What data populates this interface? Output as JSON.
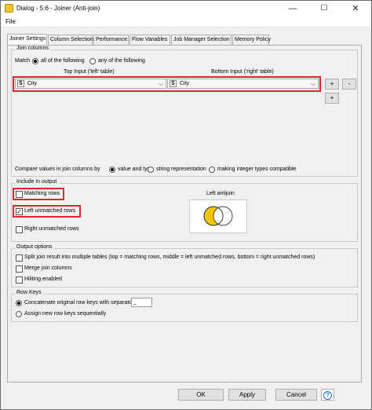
{
  "window": {
    "title": "Dialog - 5:6 - Joiner (Anti-join)",
    "minimize": "—",
    "maximize": "☐",
    "close": "✕"
  },
  "menu": {
    "file": "File"
  },
  "tabs": [
    "Joiner Settings",
    "Column Selection",
    "Performance",
    "Flow Variables",
    "Job Manager Selection",
    "Memory Policy"
  ],
  "join_columns": {
    "legend": "Join columns",
    "match_label": "Match",
    "match_all": "all of the following",
    "match_any": "any of the following",
    "top_header": "Top Input ('left' table)",
    "bottom_header": "Bottom Input ('right' table)",
    "left_column": "City",
    "right_column": "City",
    "type_badge": "S",
    "add": "+",
    "remove": "-",
    "compare_label": "Compare values in join columns by",
    "compare_value_type": "value and type",
    "compare_string": "string representation",
    "compare_integer": "making integer types compatible"
  },
  "include": {
    "legend": "Include in output",
    "matching_rows": "Matching rows",
    "matching_rows_checked": false,
    "left_unmatched": "Left unmatched rows",
    "left_unmatched_checked": true,
    "right_unmatched": "Right unmatched rows",
    "right_unmatched_checked": false,
    "venn_title": "Left antijoin",
    "venn_fill_color": "#f5c400"
  },
  "output_options": {
    "legend": "Output options",
    "split": "Split join result into multiple tables (top = matching rows, middle = left unmatched rows, bottom = right unmatched rows)",
    "merge": "Merge join columns",
    "hiliting": "Hiliting enabled"
  },
  "row_keys": {
    "legend": "Row Keys",
    "concatenate": "Concatenate original row keys with separator",
    "separator": "_",
    "assign_new": "Assign new row keys sequentially"
  },
  "buttons": {
    "ok": "OK",
    "apply": "Apply",
    "cancel": "Cancel",
    "help": "?"
  },
  "colors": {
    "highlight": "#d9262f",
    "help_blue": "#1e6fd9"
  }
}
